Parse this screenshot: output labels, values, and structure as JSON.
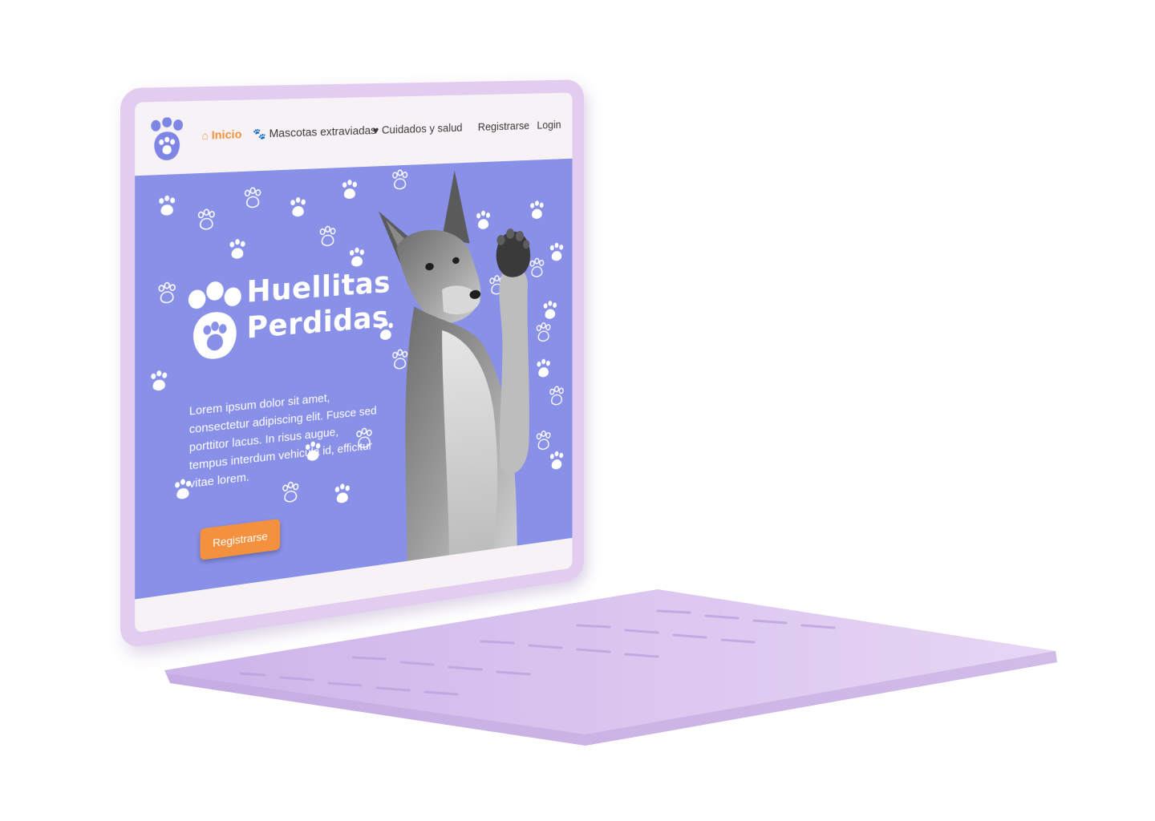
{
  "nav": {
    "logo_icon": "paw-logo-icon",
    "items": [
      {
        "label": "Inicio",
        "icon": "home-icon",
        "active": true
      },
      {
        "label": "Mascotas extraviadas",
        "icon": "paw-icon",
        "active": false
      },
      {
        "label": "Cuidados y salud",
        "icon": "heart-icon",
        "active": false
      }
    ],
    "register_label": "Registrarse",
    "login_label": "Login"
  },
  "hero": {
    "title_line1": "Huellitas",
    "title_line2": "Perdidas",
    "description": "Lorem ipsum dolor sit amet, consectetur adipiscing elit. Fusce sed porttitor lacus. In risus augue, tempus interdum vehicula id, efficitur vitae lorem.",
    "cta_label": "Registrarse",
    "image": "dog-photo"
  },
  "colors": {
    "accent": "#f3913e",
    "hero_bg": "#8890e8",
    "laptop_body": "#e2cdf1",
    "nav_bg": "#f6f2f5"
  }
}
